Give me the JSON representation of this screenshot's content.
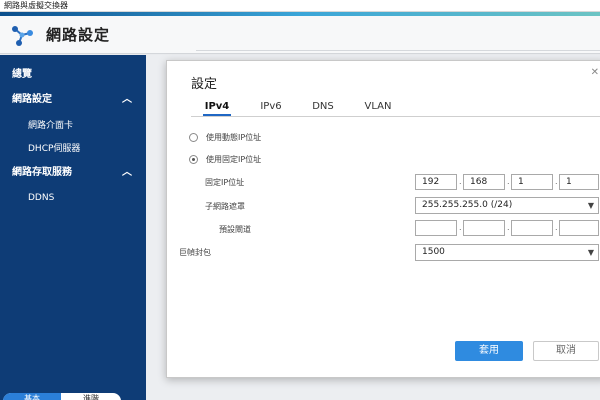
{
  "window": {
    "title": "網路與虛擬交換器"
  },
  "app": {
    "title": "網路設定",
    "icon": "network-nodes-icon"
  },
  "sidebar": {
    "items": [
      {
        "label": "總覽",
        "level": "top"
      },
      {
        "label": "網路設定",
        "level": "top",
        "expanded": true
      },
      {
        "label": "網路介面卡",
        "level": "sub"
      },
      {
        "label": "DHCP伺服器",
        "level": "sub"
      },
      {
        "label": "網路存取服務",
        "level": "top",
        "expanded": true
      },
      {
        "label": "DDNS",
        "level": "sub"
      }
    ],
    "buttons": [
      {
        "label": "基本"
      },
      {
        "label": "進階"
      }
    ]
  },
  "dialog": {
    "title": "設定",
    "tabs": [
      {
        "label": "IPv4",
        "active": true
      },
      {
        "label": "IPv6"
      },
      {
        "label": "DNS"
      },
      {
        "label": "VLAN"
      }
    ],
    "radio_dynamic": {
      "label": "使用動態IP位址",
      "checked": false
    },
    "radio_static": {
      "label": "使用固定IP位址",
      "checked": true
    },
    "fixed_ip": {
      "label": "固定IP位址",
      "octets": [
        "192",
        "168",
        "1",
        "1"
      ]
    },
    "subnet": {
      "label": "子網路遮罩",
      "value": "255.255.255.0 (/24)"
    },
    "gateway": {
      "label": "預設閘道",
      "octets": [
        "",
        "",
        "",
        ""
      ]
    },
    "jumbo": {
      "label": "巨幀封包",
      "value": "1500"
    },
    "apply_label": "套用",
    "cancel_label": "取消"
  },
  "colors": {
    "sidebar": "#0e3c76",
    "accent": "#2f8be0",
    "tab_active": "#1f67c4"
  }
}
